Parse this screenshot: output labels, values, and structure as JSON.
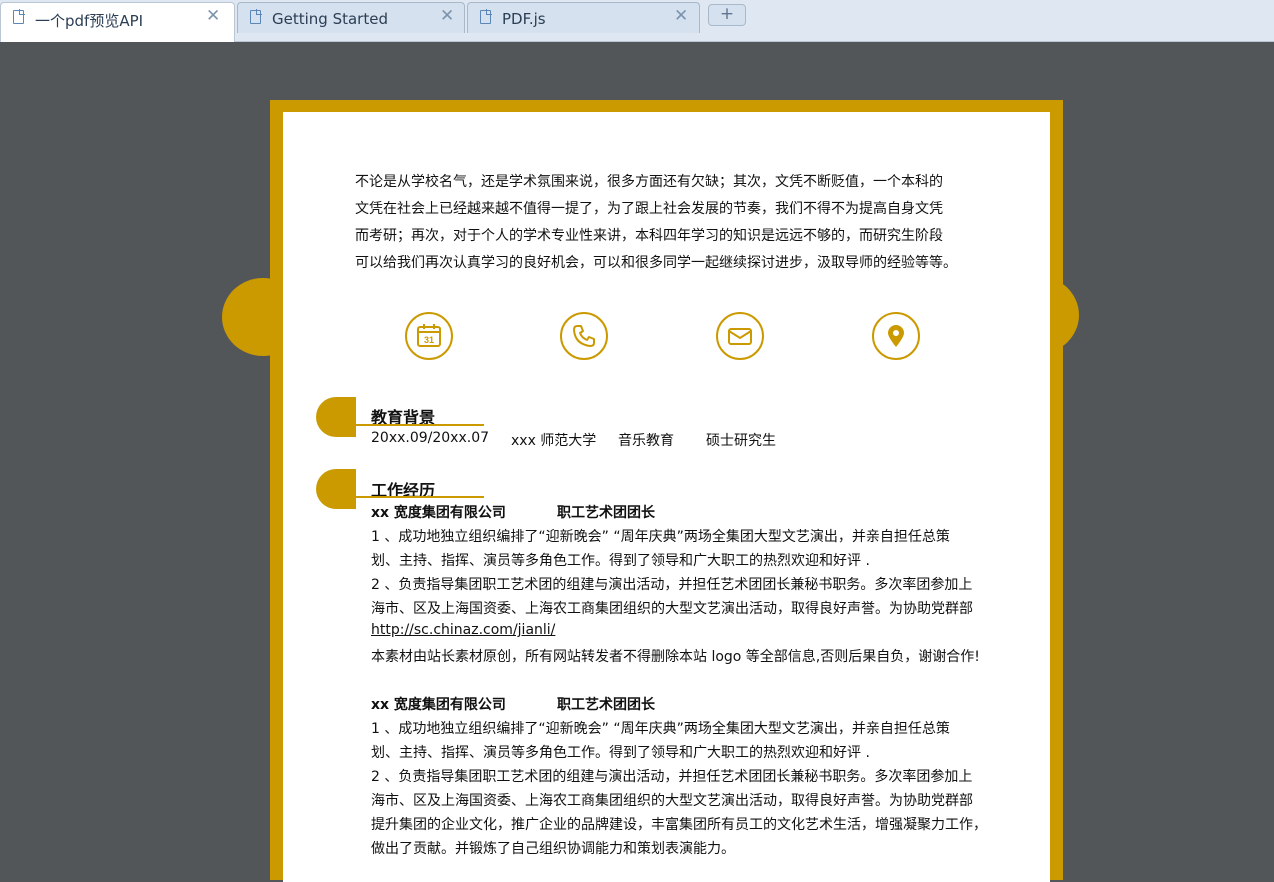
{
  "tabs": [
    {
      "label": "一个pdf预览API",
      "active": true
    },
    {
      "label": "Getting Started",
      "active": false
    },
    {
      "label": "PDF.js",
      "active": false
    }
  ],
  "new_tab_label": "+",
  "close_glyph": "✕",
  "colors": {
    "accent": "#cb9a00",
    "viewer_bg": "#525659",
    "tabbar_bg": "#dfe8f2"
  },
  "document": {
    "intro_lines": [
      "不论是从学校名气，还是学术氛围来说，很多方面还有欠缺；其次，文凭不断贬值，一个本科的",
      "文凭在社会上已经越来越不值得一提了，为了跟上社会发展的节奏，我们不得不为提高自身文凭",
      "而考研；再次，对于个人的学术专业性来讲，本科四年学习的知识是远远不够的，而研究生阶段",
      "可以给我们再次认真学习的良好机会，可以和很多同学一起继续探讨进步，汲取导师的经验等等。"
    ],
    "contact_icons": [
      "calendar-icon",
      "phone-icon",
      "mail-icon",
      "location-icon"
    ],
    "calendar_day": "31",
    "education": {
      "title": "教育背景",
      "period": "20xx.09/20xx.07",
      "school": "xxx 师范大学",
      "major": "音乐教育",
      "degree": "硕士研究生"
    },
    "work": {
      "title": "工作经历",
      "entries": [
        {
          "company": "xx 宽度集团有限公司",
          "position": "职工艺术团团长",
          "lines": [
            "1 、成功地独立组织编排了“迎新晚会” “周年庆典”两场全集团大型文艺演出，并亲自担任总策",
            "划、主持、指挥、演员等多角色工作。得到了领导和广大职工的热烈欢迎和好评 .",
            "2 、负责指导集团职工艺术团的组建与演出活动，并担任艺术团团长兼秘书职务。多次率团参加上",
            "海市、区及上海国资委、上海农工商集团组织的大型文艺演出活动，取得良好声誉。为协助党群部",
            "http://sc.chinaz.com/jianli/",
            "本素材由站长素材原创，所有网站转发者不得删除本站 logo 等全部信息,否则后果自负，谢谢合作!"
          ]
        },
        {
          "company": "xx 宽度集团有限公司",
          "position": "职工艺术团团长",
          "lines": [
            "1 、成功地独立组织编排了“迎新晚会” “周年庆典”两场全集团大型文艺演出，并亲自担任总策",
            "划、主持、指挥、演员等多角色工作。得到了领导和广大职工的热烈欢迎和好评 .",
            "2 、负责指导集团职工艺术团的组建与演出活动，并担任艺术团团长兼秘书职务。多次率团参加上",
            "海市、区及上海国资委、上海农工商集团组织的大型文艺演出活动，取得良好声誉。为协助党群部",
            "提升集团的企业文化，推广企业的品牌建设，丰富集团所有员工的文化艺术生活，增强凝聚力工作，",
            "做出了贡献。并锻炼了自己组织协调能力和策划表演能力。"
          ]
        }
      ]
    }
  }
}
